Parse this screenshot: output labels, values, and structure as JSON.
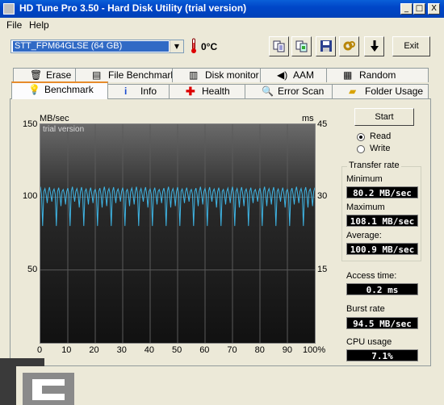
{
  "window": {
    "title": "HD Tune Pro 3.50 - Hard Disk Utility (trial version)",
    "minimize": "_",
    "maximize": "□",
    "close": "X"
  },
  "menu": {
    "file": "File",
    "help": "Help"
  },
  "toolbar": {
    "drive": "STT_FPM64GLSE (64 GB)",
    "temperature": "0°C",
    "exit_label": "Exit",
    "icons": [
      "copy-text-icon",
      "copy-screen-icon",
      "save-icon",
      "options-icon",
      "down-arrow-icon"
    ]
  },
  "tabs_top": [
    {
      "label": "Erase",
      "icon": "trash-icon"
    },
    {
      "label": "File Benchmark",
      "icon": "file-benchmark-icon"
    },
    {
      "label": "Disk monitor",
      "icon": "disk-monitor-icon"
    },
    {
      "label": "AAM",
      "icon": "speaker-icon"
    },
    {
      "label": "Random Access",
      "icon": "random-access-icon"
    }
  ],
  "tabs_bottom": [
    {
      "label": "Benchmark",
      "icon": "benchmark-icon",
      "active": true
    },
    {
      "label": "Info",
      "icon": "info-icon"
    },
    {
      "label": "Health",
      "icon": "health-cross-icon"
    },
    {
      "label": "Error Scan",
      "icon": "magnifier-icon"
    },
    {
      "label": "Folder Usage",
      "icon": "folder-icon"
    }
  ],
  "graph": {
    "left_unit": "MB/sec",
    "right_unit": "ms",
    "watermark": "trial version",
    "y_left_ticks": [
      "150",
      "100",
      "50"
    ],
    "y_right_ticks": [
      "45",
      "30",
      "15"
    ],
    "x_ticks": [
      "0",
      "10",
      "20",
      "30",
      "40",
      "50",
      "60",
      "70",
      "80",
      "90",
      "100%"
    ]
  },
  "chart_data": {
    "type": "line",
    "series": [
      {
        "color": "#3fb6e6",
        "y_min": 80.2,
        "y_max": 108.1,
        "y_avg": 100.9
      }
    ],
    "ylim": [
      0,
      150
    ],
    "y2lim": [
      0,
      45
    ],
    "xlim": [
      0,
      100
    ],
    "grid": true
  },
  "side": {
    "start_label": "Start",
    "read_label": "Read",
    "write_label": "Write",
    "read_selected": true,
    "transfer_title": "Transfer rate",
    "min_label": "Minimum",
    "min_value": "80.2 MB/sec",
    "max_label": "Maximum",
    "max_value": "108.1 MB/sec",
    "avg_label": "Average:",
    "avg_value": "100.9 MB/sec",
    "access_label": "Access time:",
    "access_value": "0.2 ms",
    "burst_label": "Burst rate",
    "burst_value": "94.5 MB/sec",
    "cpu_label": "CPU usage",
    "cpu_value": "7.1%"
  },
  "colors": {
    "titlebar": "#0046c8",
    "trace": "#3fb6e6",
    "lcd_bg": "#000000",
    "tab_accent": "#e68b2c"
  }
}
